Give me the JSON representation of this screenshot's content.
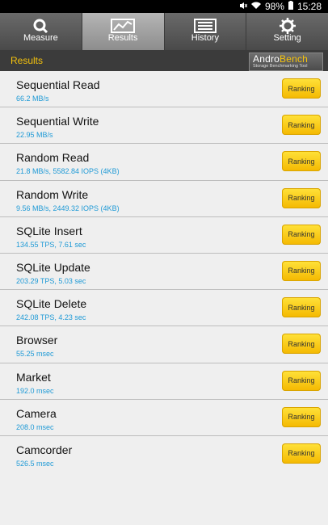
{
  "status": {
    "battery": "98%",
    "time": "15:28"
  },
  "tabs": [
    {
      "label": "Measure",
      "icon": "search-icon"
    },
    {
      "label": "Results",
      "icon": "chart-icon"
    },
    {
      "label": "History",
      "icon": "list-icon"
    },
    {
      "label": "Setting",
      "icon": "gear-icon"
    }
  ],
  "header": {
    "title": "Results",
    "logo_andro": "Andro",
    "logo_bench": "Bench",
    "logo_sub": "Storage Benchmarking Tool"
  },
  "ranking_label": "Ranking",
  "results": [
    {
      "name": "Sequential Read",
      "value": "66.2 MB/s"
    },
    {
      "name": "Sequential Write",
      "value": "22.95 MB/s"
    },
    {
      "name": "Random Read",
      "value": "21.8 MB/s, 5582.84 IOPS (4KB)"
    },
    {
      "name": "Random Write",
      "value": "9.56 MB/s, 2449.32 IOPS (4KB)"
    },
    {
      "name": "SQLite Insert",
      "value": "134.55 TPS, 7.61 sec"
    },
    {
      "name": "SQLite Update",
      "value": "203.29 TPS, 5.03 sec"
    },
    {
      "name": "SQLite Delete",
      "value": "242.08 TPS, 4.23 sec"
    },
    {
      "name": "Browser",
      "value": "55.25 msec"
    },
    {
      "name": "Market",
      "value": "192.0 msec"
    },
    {
      "name": "Camera",
      "value": "208.0 msec"
    },
    {
      "name": "Camcorder",
      "value": "526.5 msec"
    }
  ]
}
